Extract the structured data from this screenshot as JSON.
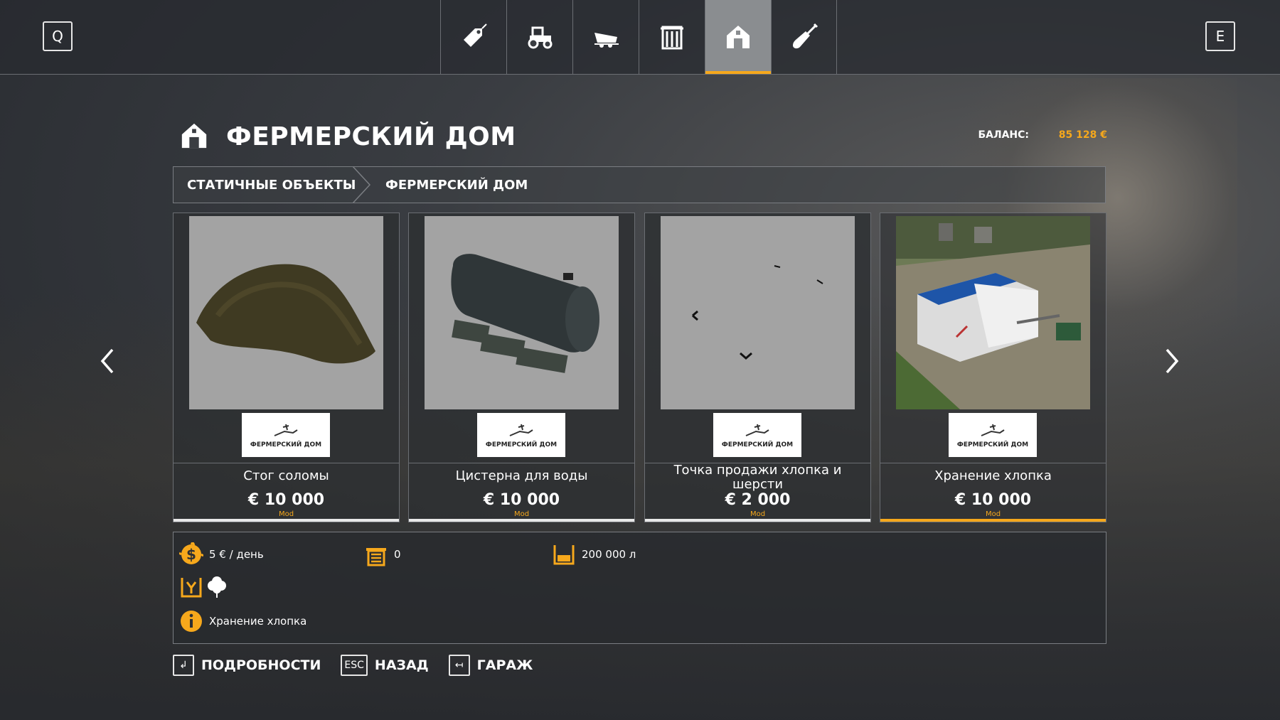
{
  "header": {
    "key_left": "Q",
    "key_right": "E",
    "tabs": [
      {
        "icon": "price-tag-icon",
        "active": false
      },
      {
        "icon": "tractor-icon",
        "active": false
      },
      {
        "icon": "trailer-icon",
        "active": false
      },
      {
        "icon": "silo-icon",
        "active": false
      },
      {
        "icon": "farmhouse-icon",
        "active": true
      },
      {
        "icon": "shovel-icon",
        "active": false
      }
    ]
  },
  "page": {
    "title": "ФЕРМЕРСКИЙ ДОМ",
    "balance_label": "БАЛАНС:",
    "balance_value": "85 128 €"
  },
  "breadcrumb": {
    "first": "СТАТИЧНЫЕ ОБЪЕКТЫ",
    "second": "ФЕРМЕРСКИЙ ДОМ"
  },
  "cards": [
    {
      "name": "Стог соломы",
      "price": "€ 10 000",
      "tag": "Mod",
      "logo_text": "ФЕРМЕРСКИЙ ДОМ",
      "image": "straw-pile"
    },
    {
      "name": "Цистерна для воды",
      "price": "€ 10 000",
      "tag": "Mod",
      "logo_text": "ФЕРМЕРСКИЙ ДОМ",
      "image": "water-tank"
    },
    {
      "name": "Точка продажи хлопка и шерсти",
      "price": "€ 2 000",
      "tag": "Mod",
      "logo_text": "ФЕРМЕРСКИЙ ДОМ",
      "image": "selling-point"
    },
    {
      "name": "Хранение хлопка",
      "price": "€ 10 000",
      "tag": "Mod",
      "logo_text": "ФЕРМЕРСКИЙ ДОМ",
      "image": "cotton-storage",
      "selected": true
    }
  ],
  "info": {
    "upkeep": "5 € / день",
    "slots": "0",
    "capacity": "200 000 л",
    "description": "Хранение хлопка"
  },
  "footer": {
    "details_key": "↲",
    "details_label": "ПОДРОБНОСТИ",
    "back_key": "ESC",
    "back_label": "НАЗАД",
    "garage_key": "↤",
    "garage_label": "ГАРАЖ"
  },
  "colors": {
    "accent": "#f6a81c",
    "tab_active_bg": "#8a8d90"
  }
}
